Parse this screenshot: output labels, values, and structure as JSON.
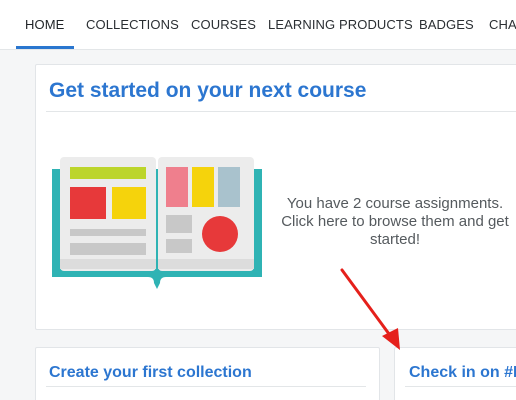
{
  "nav": {
    "tabs": [
      {
        "label": "HOME",
        "active": true
      },
      {
        "label": "COLLECTIONS"
      },
      {
        "label": "COURSES"
      },
      {
        "label": "LEARNING PRODUCTS"
      },
      {
        "label": "BADGES"
      },
      {
        "label": "CHA"
      }
    ]
  },
  "main_card": {
    "title": "Get started on your next course",
    "message": "You have 2 course assignments. Click here to browse them and get started!"
  },
  "collection_card": {
    "title": "Create your first collection"
  },
  "checkin_card": {
    "title": "Check in on #N"
  },
  "colors": {
    "accent": "#2c76d0",
    "arrow": "#e5201b",
    "book_teal": "#2fb3b4",
    "lime": "#bcd52b",
    "red": "#e7393a",
    "yellow": "#f5d30c",
    "pink": "#ef7f8d",
    "blue_grey": "#a9c2cd",
    "gray": "#c8c8c8"
  }
}
